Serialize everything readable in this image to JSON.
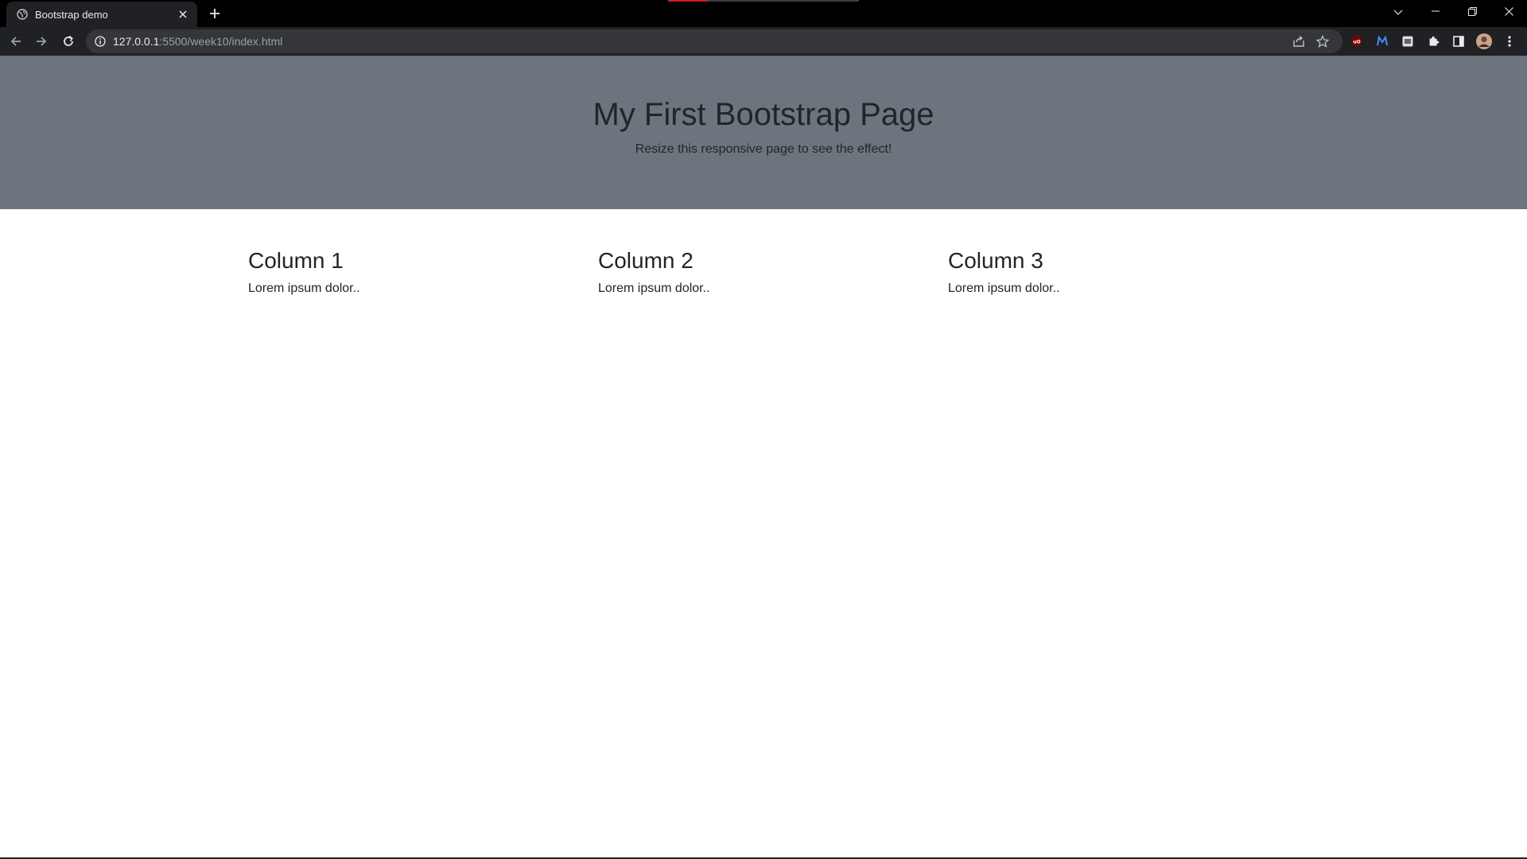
{
  "browser": {
    "tab": {
      "title": "Bootstrap demo",
      "favicon": "globe-icon"
    },
    "url": {
      "host": "127.0.0.1",
      "rest": ":5500/week10/index.html"
    },
    "extensions": [
      "ublock-icon",
      "m-extension-icon",
      "puzzle-icon",
      "sidepanel-icon",
      "avatar"
    ]
  },
  "page": {
    "jumbotron": {
      "title": "My First Bootstrap Page",
      "subtitle": "Resize this responsive page to see the effect!"
    },
    "columns": [
      {
        "heading": "Column 1",
        "text": "Lorem ipsum dolor.."
      },
      {
        "heading": "Column 2",
        "text": "Lorem ipsum dolor.."
      },
      {
        "heading": "Column 3",
        "text": "Lorem ipsum dolor.."
      }
    ]
  },
  "colors": {
    "jumbotron_bg": "#6c757d",
    "text": "#212529",
    "chrome_bg": "#202124"
  }
}
